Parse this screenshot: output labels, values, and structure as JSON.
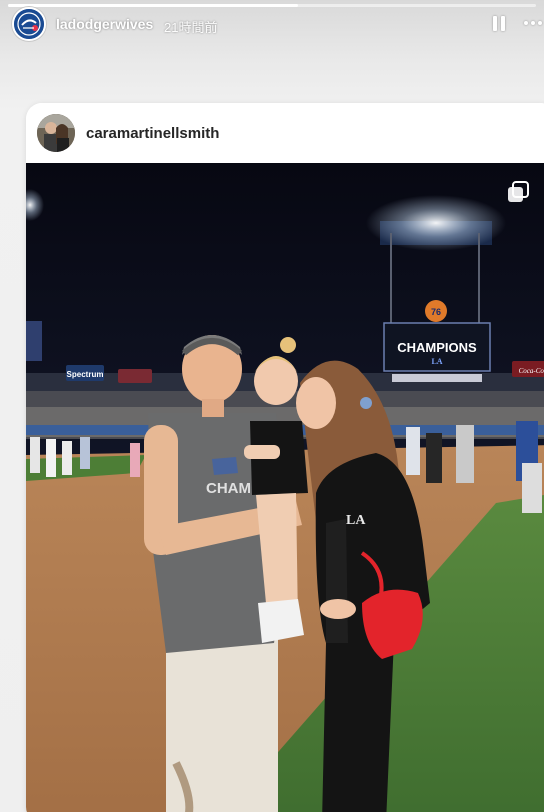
{
  "story": {
    "username": "ladodgerwives",
    "time": "21時間前",
    "progress_fraction": 0.55
  },
  "post": {
    "username": "caramartinellsmith"
  },
  "scoreboard": {
    "title": "CHAMPIONS",
    "logo_letters": "LA"
  },
  "signs": {
    "left_banner": "Spectrum",
    "right_banner": "Coca-Cola",
    "gas_sign": "76"
  },
  "shirt_text": "CHAMPI",
  "jacket_letters": "LA",
  "icons": {
    "pause": "pause-icon",
    "more": "more-icon",
    "carousel": "carousel-icon",
    "story_avatar": "dodgers-logo-icon"
  },
  "colors": {
    "sky": "#0b0d1a",
    "field_dirt": "#b07a50",
    "field_grass": "#4f7d3a",
    "bag": "#e3242b"
  }
}
